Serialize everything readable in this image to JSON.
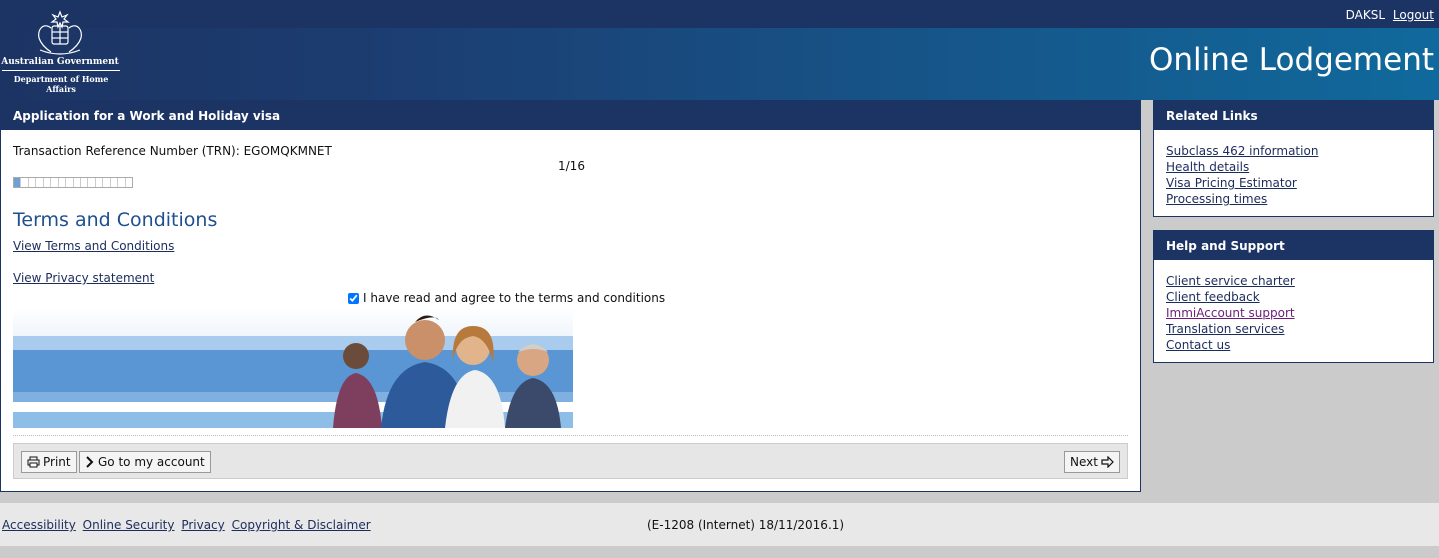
{
  "header": {
    "agency_line1": "Australian Government",
    "agency_line2": "Department of Home Affairs",
    "username": "DAKSL",
    "logout_label": "Logout",
    "app_title": "Online Lodgement"
  },
  "main": {
    "heading": "Application for a Work and Holiday visa",
    "trn_text": "Transaction Reference Number (TRN): EGOMQKMNET",
    "step_text": "1/16",
    "progress": {
      "current": 1,
      "total": 16
    },
    "section_title": "Terms and Conditions",
    "view_terms_link": "View Terms and Conditions",
    "view_privacy_link": "View Privacy statement",
    "agree_label": "I have read and agree to the terms and conditions",
    "agree_checked": true,
    "buttons": {
      "print": "Print",
      "account": "Go to my account",
      "next": "Next"
    }
  },
  "related_links": {
    "heading": "Related Links",
    "items": [
      "Subclass 462 information",
      "Health details",
      "Visa Pricing Estimator",
      "Processing times"
    ]
  },
  "help_support": {
    "heading": "Help and Support",
    "items": [
      "Client service charter",
      "Client feedback",
      "ImmiAccount support",
      "Translation services",
      "Contact us"
    ]
  },
  "footer": {
    "links": [
      "Accessibility",
      "Online Security",
      "Privacy",
      "Copyright & Disclaimer"
    ],
    "version": "(E-1208 (Internet) 18/11/2016.1)"
  },
  "colors": {
    "header_navy": "#1c3464",
    "header_blue": "#10699c",
    "link": "#1c2c5c",
    "visited_link": "#6a1f76",
    "section_title": "#1f4f8f",
    "progress_fill": "#6e9fd6"
  },
  "icons": [
    "coat-of-arms-icon",
    "printer-icon",
    "chevron-right-icon",
    "arrow-right-icon"
  ]
}
